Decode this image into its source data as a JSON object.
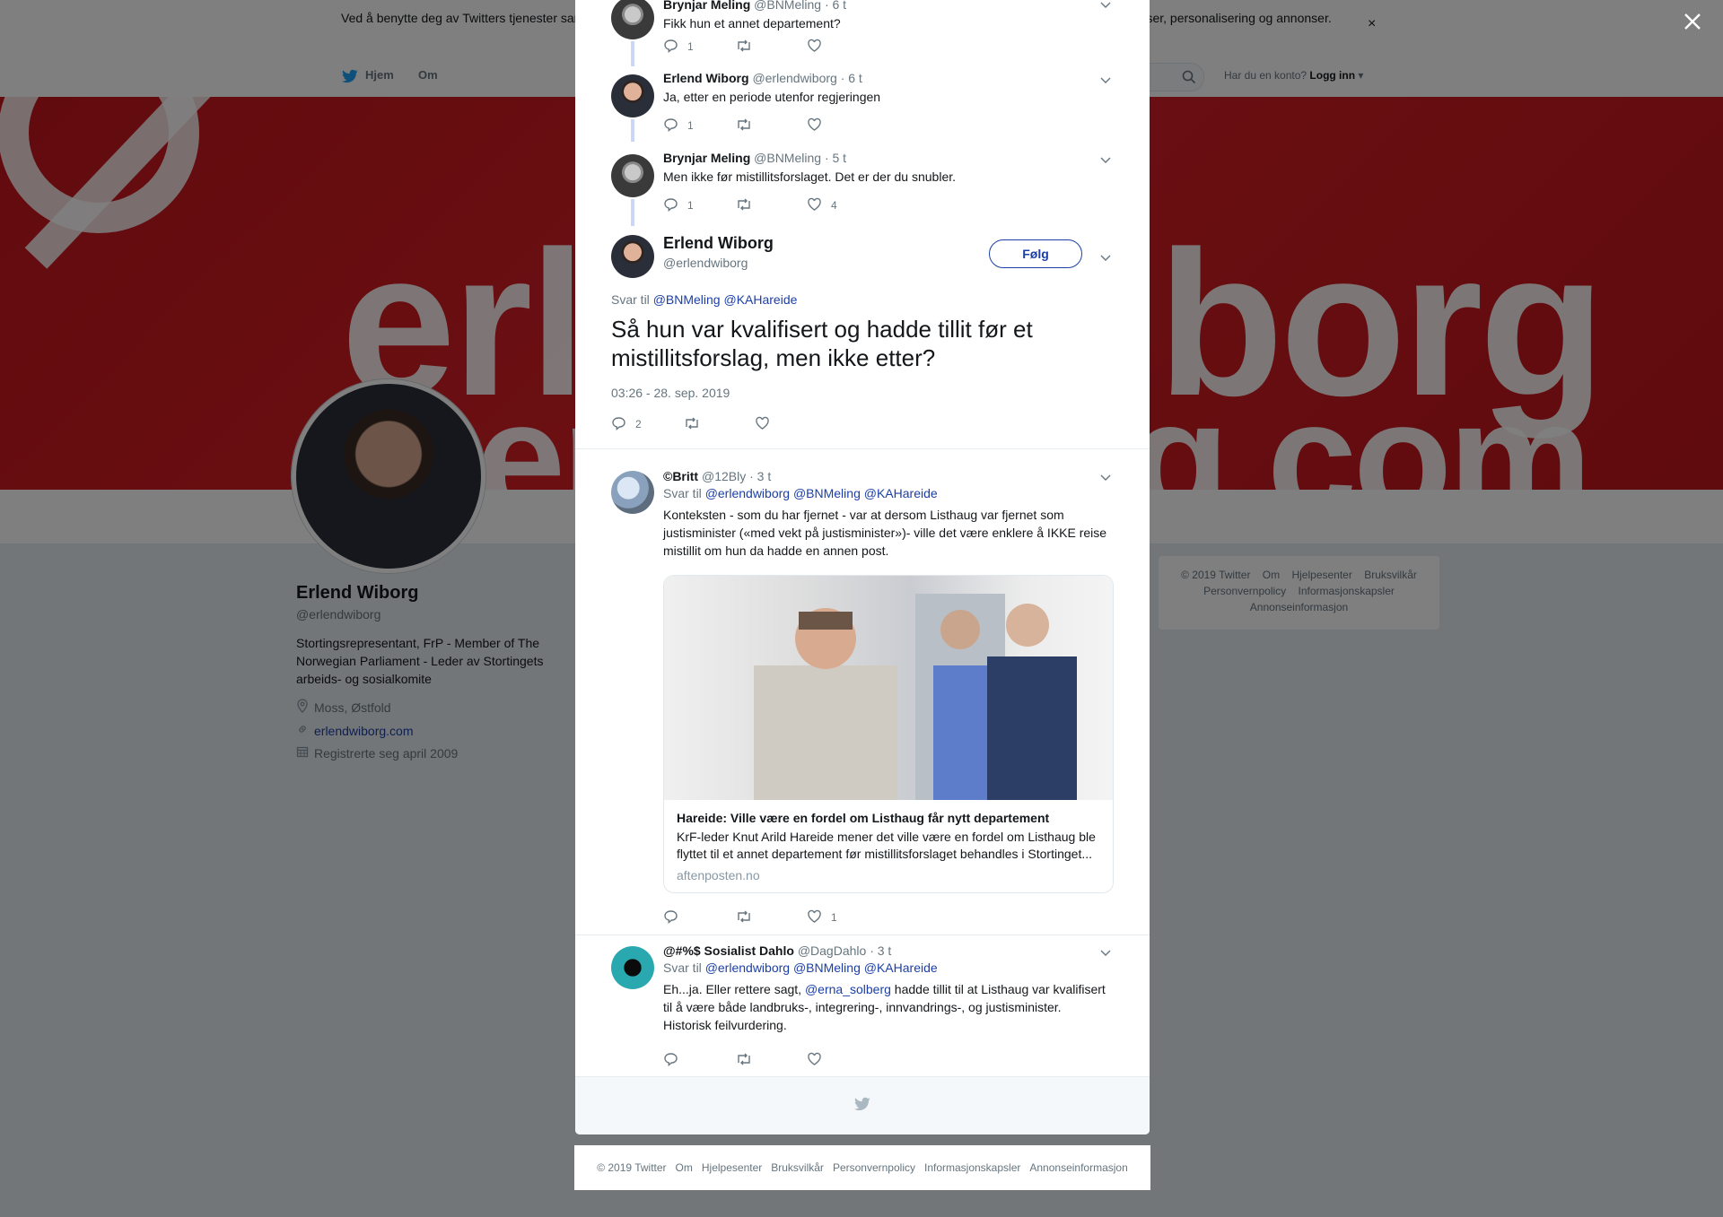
{
  "cookie_banner": {
    "text": "Ved å benytte deg av Twitters tjenester samtykker du til bruk av informasjonskapsler. Twitter og partnere bruker informasjonskapsler til bl.a. analyser, personalisering og annonser.",
    "close": "×"
  },
  "nav": {
    "home": "Hjem",
    "about": "Om",
    "login_prompt": "Har du en konto?",
    "login": "Logg inn"
  },
  "banner": {
    "word1": "erl",
    "word2": "iborg",
    "word3": "er",
    "word4": "g.com"
  },
  "profile": {
    "name": "Erlend Wiborg",
    "handle": "@erlendwiborg",
    "bio": "Stortingsrepresentant, FrP - Member of The Norwegian Parliament - Leder av Stortingets arbeids- og sosialkomite",
    "location": "Moss, Østfold",
    "website": "erlendwiborg.com",
    "joined": "Registrerte seg april 2009"
  },
  "side_footer": {
    "items": [
      "© 2019 Twitter",
      "Om",
      "Hjelpesenter",
      "Bruksvilkår",
      "Personvernpolicy",
      "Informasjonskapsler",
      "Annonseinformasjon"
    ]
  },
  "thread": [
    {
      "name": "Brynjar Meling",
      "handle": "@BNMeling",
      "time": "· 6 t",
      "text": "Fikk hun et annet departement?",
      "replies": "1",
      "retweets": "",
      "likes": ""
    },
    {
      "name": "Erlend Wiborg",
      "handle": "@erlendwiborg",
      "time": "· 6 t",
      "text": "Ja, etter en periode utenfor regjeringen",
      "replies": "1",
      "retweets": "",
      "likes": ""
    },
    {
      "name": "Brynjar Meling",
      "handle": "@BNMeling",
      "time": "· 5 t",
      "text": "Men ikke før mistillitsforslaget. Det er der du snubler.",
      "replies": "1",
      "retweets": "",
      "likes": "4"
    }
  ],
  "main_tweet": {
    "name": "Erlend Wiborg",
    "handle": "@erlendwiborg",
    "follow": "Følg",
    "reply_to_label": "Svar til",
    "reply_to_1": "@BNMeling",
    "reply_to_2": "@KAHareide",
    "text": "Så hun var kvalifisert og hadde tillit før et mistillitsforslag, men ikke etter?",
    "timestamp": "03:26 - 28. sep. 2019",
    "replies": "2",
    "retweets": "",
    "likes": ""
  },
  "replies": [
    {
      "name": "©Britt",
      "handle": "@12Bly",
      "time": "· 3 t",
      "reply_to_label": "Svar til",
      "reply_to": [
        "@erlendwiborg",
        "@BNMeling",
        "@KAHareide"
      ],
      "text": "Konteksten - som du har fjernet - var at dersom Listhaug var fjernet som justisminister («med vekt på justisminister»)- ville det være enklere å IKKE reise mistillit om hun da hadde en annen post.",
      "card": {
        "title": "Hareide: Ville være en fordel om Listhaug får nytt departement",
        "description": "KrF-leder Knut Arild Hareide mener det ville være en fordel om Listhaug ble flyttet til et annet departement før mistillitsforslaget behandles i Stortinget...",
        "domain": "aftenposten.no"
      },
      "replies": "",
      "retweets": "",
      "likes": "1"
    },
    {
      "name": "@#%$ Sosialist Dahlo",
      "handle": "@DagDahlo",
      "time": "· 3 t",
      "reply_to_label": "Svar til",
      "reply_to": [
        "@erlendwiborg",
        "@BNMeling",
        "@KAHareide"
      ],
      "text_before": "Eh...ja. Eller rettere sagt,",
      "mention": "@erna_solberg",
      "text_after": "hadde tillit til at Listhaug var kvalifisert til å være både landbruks-, integrering-, innvandrings-, og justisminister. Historisk feilvurdering.",
      "replies": "",
      "retweets": "",
      "likes": ""
    }
  ],
  "bottom_footer": {
    "items": [
      "© 2019 Twitter",
      "Om",
      "Hjelpesenter",
      "Bruksvilkår",
      "Personvernpolicy",
      "Informasjonskapsler",
      "Annonseinformasjon"
    ]
  },
  "colors": {
    "link": "#1b3fa6",
    "banner_red": "#c4161c",
    "muted": "#66757f"
  }
}
